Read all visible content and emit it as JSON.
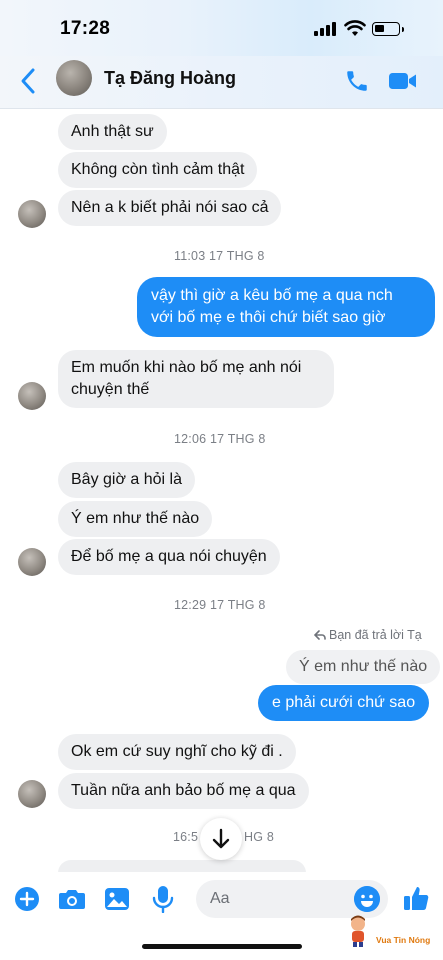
{
  "status_bar": {
    "time": "17:28"
  },
  "header": {
    "contact_name": "Tạ Đăng Hoàng"
  },
  "messages": {
    "m1": "Anh thật sư",
    "m2": "Không còn tình cảm thật",
    "m3": "Nên a k biết phải nói sao cả",
    "t1": "11:03 17 THG 8",
    "m4a": "vậy thì giờ a kêu bố mẹ a qua nch",
    "m4b": "với bố mẹ e thôi chứ biết sao giờ",
    "m5a": "Em muốn khi nào bố mẹ anh nói",
    "m5b": "chuyện thế",
    "t2": "12:06 17 THG 8",
    "m6": "Bây giờ a hỏi là",
    "m7": "Ý em như thế nào",
    "m8": "Để bố mẹ a qua nói chuyện",
    "t3": "12:29 17 THG 8",
    "reply_label": "Bạn đã trả lời Tạ",
    "quoted": "Ý em như thế nào",
    "m9": "e phải cưới chứ sao",
    "m10": "Ok em cứ suy nghĩ cho kỹ đi .",
    "m11": "Tuần nữa anh bảo bố mẹ a qua",
    "t4_left": "16:5",
    "t4_right": "HG 8"
  },
  "composer": {
    "placeholder": "Aa"
  },
  "watermark": {
    "text": "Vua Tin Nóng"
  },
  "colors": {
    "accent": "#1e8df6",
    "incoming_bubble": "#eeeff1"
  }
}
